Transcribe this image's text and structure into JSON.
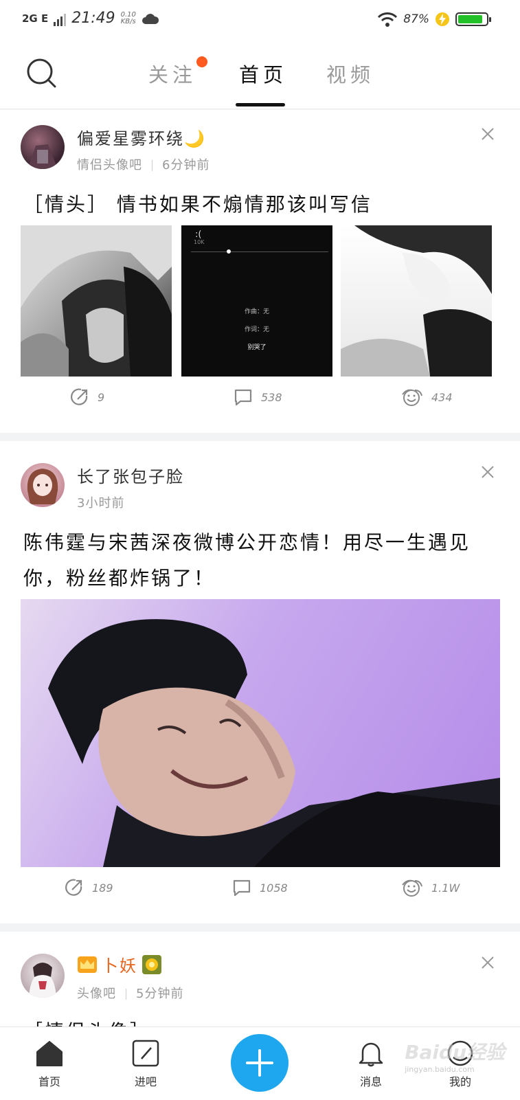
{
  "status_bar": {
    "network": "2G E",
    "time": "21:49",
    "speed_value": "0.10",
    "speed_unit": "KB/s",
    "battery_percent": "87%",
    "battery_level": 0.87,
    "battery_color": "#22c12a"
  },
  "nav": {
    "tabs": [
      {
        "label": "关注",
        "badge": true
      },
      {
        "label": "首页",
        "active": true
      },
      {
        "label": "视频"
      }
    ],
    "badge_color": "#ff5a1f"
  },
  "posts": [
    {
      "username": "偏爱星雾环绕🌙",
      "forum": "情侣头像吧",
      "time": "6分钟前",
      "title": "［情头］  情书如果不煽情那该叫写信",
      "thumb_middle": {
        "face": ":(",
        "count": "10K",
        "line1": "作曲：无",
        "line2": "作词：无",
        "line3": "别哭了"
      },
      "shares": "9",
      "comments": "538",
      "likes": "434"
    },
    {
      "username": "长了张包子脸",
      "time": "3小时前",
      "title": "陈伟霆与宋茜深夜微博公开恋情！用尽一生遇见你，粉丝都炸锅了！",
      "shares": "189",
      "comments": "1058",
      "likes": "1.1W"
    },
    {
      "username": "卜妖",
      "forum": "头像吧",
      "time": "5分钟前",
      "title_partial": "［情侣头像］"
    }
  ],
  "bottom_nav": {
    "home": "首页",
    "enter_forum": "进吧",
    "messages": "消息",
    "mine": "我的"
  },
  "watermark": {
    "brand": "Baidu经验",
    "url": "jingyan.baidu.com"
  }
}
